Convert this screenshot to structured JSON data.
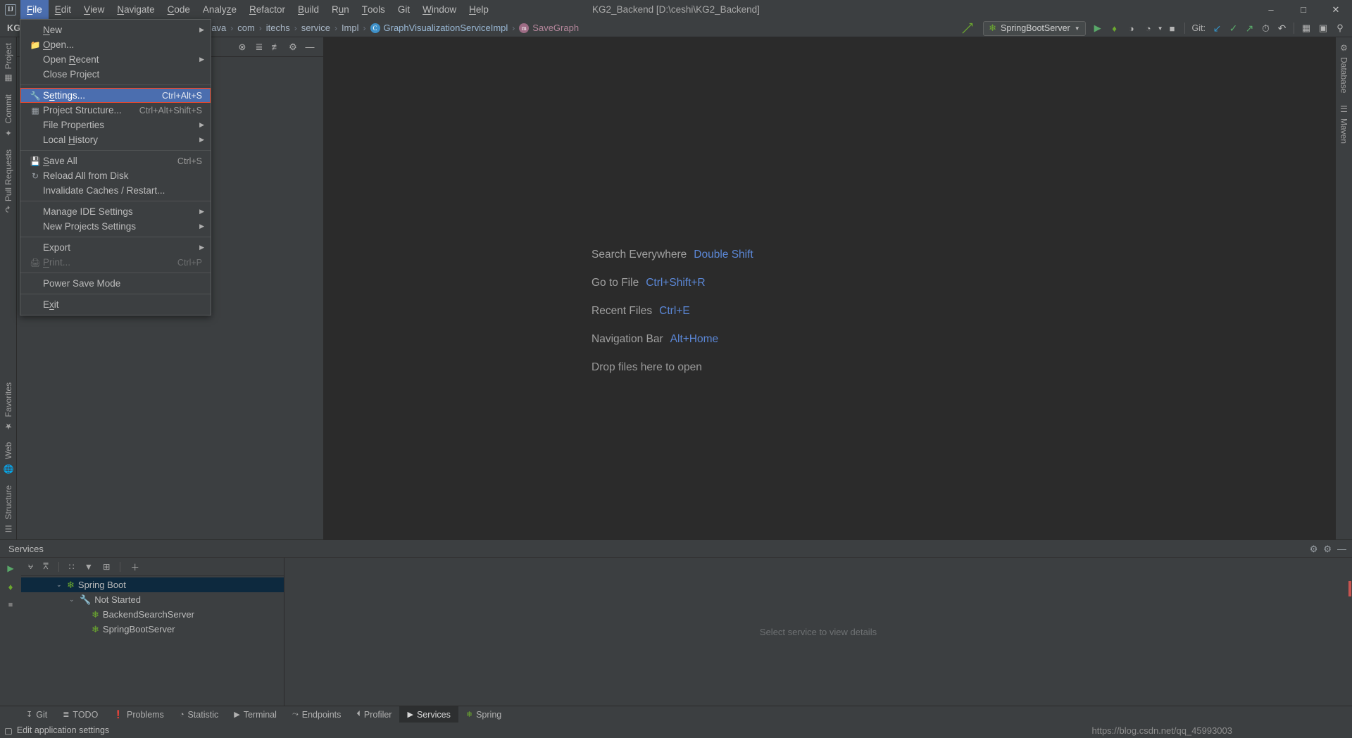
{
  "window": {
    "title": "KG2_Backend [D:\\ceshi\\KG2_Backend]",
    "logo": "IJ",
    "minimize": "–",
    "maximize": "□",
    "close": "✕"
  },
  "menubar": {
    "items": [
      {
        "label": "File",
        "mnemonic": "F",
        "active": true
      },
      {
        "label": "Edit",
        "mnemonic": "E",
        "active": false
      },
      {
        "label": "View",
        "mnemonic": "V",
        "active": false
      },
      {
        "label": "Navigate",
        "mnemonic": "N",
        "active": false
      },
      {
        "label": "Code",
        "mnemonic": "C",
        "active": false
      },
      {
        "label": "Analyze",
        "mnemonic": "z",
        "active": false
      },
      {
        "label": "Refactor",
        "mnemonic": "R",
        "active": false
      },
      {
        "label": "Build",
        "mnemonic": "B",
        "active": false
      },
      {
        "label": "Run",
        "mnemonic": "u",
        "active": false
      },
      {
        "label": "Tools",
        "mnemonic": "T",
        "active": false
      },
      {
        "label": "Git",
        "mnemonic": "",
        "active": false
      },
      {
        "label": "Window",
        "mnemonic": "W",
        "active": false
      },
      {
        "label": "Help",
        "mnemonic": "H",
        "active": false
      }
    ]
  },
  "file_menu": {
    "items": [
      {
        "label": "New",
        "shortcut": "",
        "icon": "",
        "submenu": true,
        "selected": false,
        "disabled": false,
        "separator_after": false
      },
      {
        "label": "Open...",
        "shortcut": "",
        "icon": "folder-icon",
        "submenu": false,
        "selected": false,
        "disabled": false,
        "separator_after": false
      },
      {
        "label": "Open Recent",
        "shortcut": "",
        "icon": "",
        "submenu": true,
        "selected": false,
        "disabled": false,
        "separator_after": false
      },
      {
        "label": "Close Project",
        "shortcut": "",
        "icon": "",
        "submenu": false,
        "selected": false,
        "disabled": false,
        "separator_after": true
      },
      {
        "label": "Settings...",
        "shortcut": "Ctrl+Alt+S",
        "icon": "wrench-icon",
        "submenu": false,
        "selected": true,
        "disabled": false,
        "separator_after": false
      },
      {
        "label": "Project Structure...",
        "shortcut": "Ctrl+Alt+Shift+S",
        "icon": "module-icon",
        "submenu": false,
        "selected": false,
        "disabled": false,
        "separator_after": false
      },
      {
        "label": "File Properties",
        "shortcut": "",
        "icon": "",
        "submenu": true,
        "selected": false,
        "disabled": false,
        "separator_after": false
      },
      {
        "label": "Local History",
        "shortcut": "",
        "icon": "",
        "submenu": true,
        "selected": false,
        "disabled": false,
        "separator_after": true
      },
      {
        "label": "Save All",
        "shortcut": "Ctrl+S",
        "icon": "save-icon",
        "submenu": false,
        "selected": false,
        "disabled": false,
        "separator_after": false
      },
      {
        "label": "Reload All from Disk",
        "shortcut": "",
        "icon": "refresh-icon",
        "submenu": false,
        "selected": false,
        "disabled": false,
        "separator_after": false
      },
      {
        "label": "Invalidate Caches / Restart...",
        "shortcut": "",
        "icon": "",
        "submenu": false,
        "selected": false,
        "disabled": false,
        "separator_after": true
      },
      {
        "label": "Manage IDE Settings",
        "shortcut": "",
        "icon": "",
        "submenu": true,
        "selected": false,
        "disabled": false,
        "separator_after": false
      },
      {
        "label": "New Projects Settings",
        "shortcut": "",
        "icon": "",
        "submenu": true,
        "selected": false,
        "disabled": false,
        "separator_after": true
      },
      {
        "label": "Export",
        "shortcut": "",
        "icon": "",
        "submenu": true,
        "selected": false,
        "disabled": false,
        "separator_after": false
      },
      {
        "label": "Print...",
        "shortcut": "Ctrl+P",
        "icon": "printer-icon",
        "submenu": false,
        "selected": false,
        "disabled": true,
        "separator_after": true
      },
      {
        "label": "Power Save Mode",
        "shortcut": "",
        "icon": "",
        "submenu": false,
        "selected": false,
        "disabled": false,
        "separator_after": true
      },
      {
        "label": "Exit",
        "shortcut": "",
        "icon": "",
        "submenu": false,
        "selected": false,
        "disabled": false,
        "separator_after": false
      }
    ]
  },
  "navbar": {
    "project_label": "KG",
    "crumbs": [
      {
        "label": "java",
        "kind": "dir"
      },
      {
        "label": "com",
        "kind": "dir"
      },
      {
        "label": "itechs",
        "kind": "dir"
      },
      {
        "label": "service",
        "kind": "dir"
      },
      {
        "label": "Impl",
        "kind": "dir"
      },
      {
        "label": "GraphVisualizationServiceImpl",
        "kind": "class",
        "icon": "C"
      },
      {
        "label": "SaveGraph",
        "kind": "method",
        "icon": "m"
      }
    ],
    "separator": "›",
    "run_config": "SpringBootServer",
    "git_label": "Git:"
  },
  "toolbar_icons": [
    {
      "name": "run-icon",
      "glyph": "▶"
    },
    {
      "name": "debug-icon",
      "glyph": "🐞"
    },
    {
      "name": "run-with-coverage-icon",
      "glyph": "◑"
    },
    {
      "name": "profiler-icon",
      "glyph": "◔"
    },
    {
      "name": "stop-icon",
      "glyph": "■"
    },
    {
      "name": "git-update-icon",
      "glyph": "↙"
    },
    {
      "name": "git-commit-icon",
      "glyph": "✓"
    },
    {
      "name": "git-push-icon",
      "glyph": "↗"
    },
    {
      "name": "git-history-icon",
      "glyph": "◴"
    },
    {
      "name": "git-revert-icon",
      "glyph": "↶"
    },
    {
      "name": "structure-icon",
      "glyph": "▤"
    },
    {
      "name": "terminal-icon",
      "glyph": "▣"
    },
    {
      "name": "search-icon",
      "glyph": "⌕"
    }
  ],
  "project_toolbar_icons": [
    {
      "name": "collapse-all-icon",
      "glyph": "⊗"
    },
    {
      "name": "expand-all-icon",
      "glyph": "≡"
    },
    {
      "name": "select-opened-file-icon",
      "glyph": "≣"
    },
    {
      "name": "settings-gear-icon",
      "glyph": "⚙"
    },
    {
      "name": "hide-icon",
      "glyph": "—"
    }
  ],
  "left_strip": [
    {
      "label": "Project",
      "icon": "project-icon"
    },
    {
      "label": "Commit",
      "icon": "commit-icon"
    },
    {
      "label": "Pull Requests",
      "icon": "pull-requests-icon"
    }
  ],
  "left_strip_bottom": [
    {
      "label": "Favorites",
      "icon": "star-icon"
    },
    {
      "label": "Web",
      "icon": "globe-icon"
    },
    {
      "label": "Structure",
      "icon": "structure-icon"
    }
  ],
  "right_strip": [
    {
      "label": "Database",
      "icon": "database-icon"
    },
    {
      "label": "Maven",
      "icon": "maven-icon"
    }
  ],
  "editor_hints": [
    {
      "action": "Search Everywhere",
      "key": "Double Shift"
    },
    {
      "action": "Go to File",
      "key": "Ctrl+Shift+R"
    },
    {
      "action": "Recent Files",
      "key": "Ctrl+E"
    },
    {
      "action": "Navigation Bar",
      "key": "Alt+Home"
    },
    {
      "action": "Drop files here to open",
      "key": ""
    }
  ],
  "services": {
    "title": "Services",
    "detail_placeholder": "Select service to view details",
    "left_buttons": [
      {
        "name": "run-service-button",
        "glyph": "▶"
      },
      {
        "name": "debug-service-button",
        "glyph": "🐞"
      },
      {
        "name": "stop-service-button",
        "glyph": "■"
      }
    ],
    "toolbar": [
      {
        "name": "expand-all-icon",
        "glyph": "⩝"
      },
      {
        "name": "collapse-all-icon",
        "glyph": "⩞"
      },
      {
        "name": "group-by-icon",
        "glyph": "∷"
      },
      {
        "name": "filter-icon",
        "glyph": "▼"
      },
      {
        "name": "add-tab-icon",
        "glyph": "⊞"
      },
      {
        "name": "add-service-icon",
        "glyph": "＋"
      }
    ],
    "tree": [
      {
        "label": "Spring Boot",
        "depth": 1,
        "selected": true,
        "chevron": "⌄",
        "icon": "spring-leaf-icon"
      },
      {
        "label": "Not Started",
        "depth": 2,
        "selected": false,
        "chevron": "⌄",
        "icon": "wrench-icon"
      },
      {
        "label": "BackendSearchServer",
        "depth": 3,
        "selected": false,
        "chevron": "",
        "icon": "spring-leaf-icon"
      },
      {
        "label": "SpringBootServer",
        "depth": 3,
        "selected": false,
        "chevron": "",
        "icon": "spring-leaf-icon"
      }
    ],
    "header_right": [
      {
        "name": "settings-gear-icon",
        "glyph": "⚙"
      },
      {
        "name": "help-icon",
        "glyph": "⚙"
      },
      {
        "name": "hide-icon",
        "glyph": "—"
      }
    ]
  },
  "bottom_tabs": [
    {
      "label": "Git",
      "icon": "⎇",
      "active": false
    },
    {
      "label": "TODO",
      "icon": "≣",
      "active": false
    },
    {
      "label": "Problems",
      "icon": "❗",
      "active": false
    },
    {
      "label": "Statistic",
      "icon": "◔",
      "active": false
    },
    {
      "label": "Terminal",
      "icon": "▶",
      "active": false
    },
    {
      "label": "Endpoints",
      "icon": "⤳",
      "active": false
    },
    {
      "label": "Profiler",
      "icon": "◴",
      "active": false
    },
    {
      "label": "Services",
      "icon": "▶",
      "active": true
    },
    {
      "label": "Spring",
      "icon": "🍃",
      "active": false
    }
  ],
  "statusbar": {
    "message": "Edit application settings",
    "icon": "▢",
    "watermark": "https://blog.csdn.net/qq_45993003"
  }
}
